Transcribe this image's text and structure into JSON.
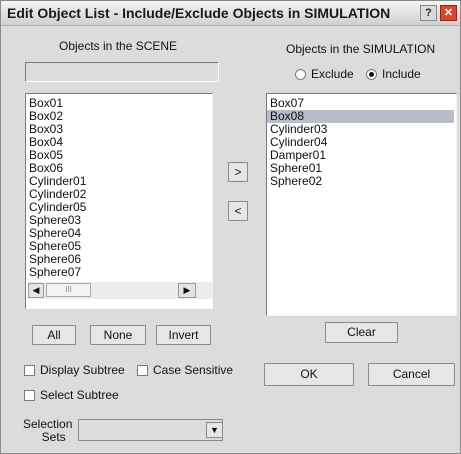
{
  "window": {
    "title": "Edit Object List - Include/Exclude Objects in SIMULATION",
    "help_glyph": "?",
    "close_glyph": "✕"
  },
  "scene": {
    "label": "Objects in the SCENE",
    "filter_value": "",
    "items": [
      "Box01",
      "Box02",
      "Box03",
      "Box04",
      "Box05",
      "Box06",
      "Cylinder01",
      "Cylinder02",
      "Cylinder05",
      "Sphere03",
      "Sphere04",
      "Sphere05",
      "Sphere06",
      "Sphere07"
    ],
    "scroll_up_glyph": "▲",
    "scroll_down_glyph": "▼",
    "scroll_left_glyph": "◀",
    "scroll_right_glyph": "▶",
    "thumb_grip": "≡",
    "hthumb_grip": "III",
    "all_button": "All",
    "none_button": "None",
    "invert_button": "Invert"
  },
  "transfer": {
    "add_glyph": ">",
    "remove_glyph": "<"
  },
  "simulation": {
    "label": "Objects in the SIMULATION",
    "exclude_label": "Exclude",
    "include_label": "Include",
    "mode_selected": "Include",
    "items": [
      "Box07",
      "Box08",
      "Cylinder03",
      "Cylinder04",
      "Damper01",
      "Sphere01",
      "Sphere02"
    ],
    "selected_item": "Box08",
    "clear_button": "Clear"
  },
  "options": {
    "display_subtree": "Display Subtree",
    "case_sensitive": "Case Sensitive",
    "select_subtree": "Select Subtree",
    "display_subtree_checked": false,
    "case_sensitive_checked": false,
    "select_subtree_checked": false
  },
  "selection_sets": {
    "label_line1": "Selection",
    "label_line2": "Sets",
    "value": "",
    "dropdown_glyph": "▼"
  },
  "footer": {
    "ok_button": "OK",
    "cancel_button": "Cancel"
  },
  "colors": {
    "dialog_bg": "#dcdcdc",
    "selected_row": "#b9bccb",
    "close_button": "#d9472f"
  }
}
